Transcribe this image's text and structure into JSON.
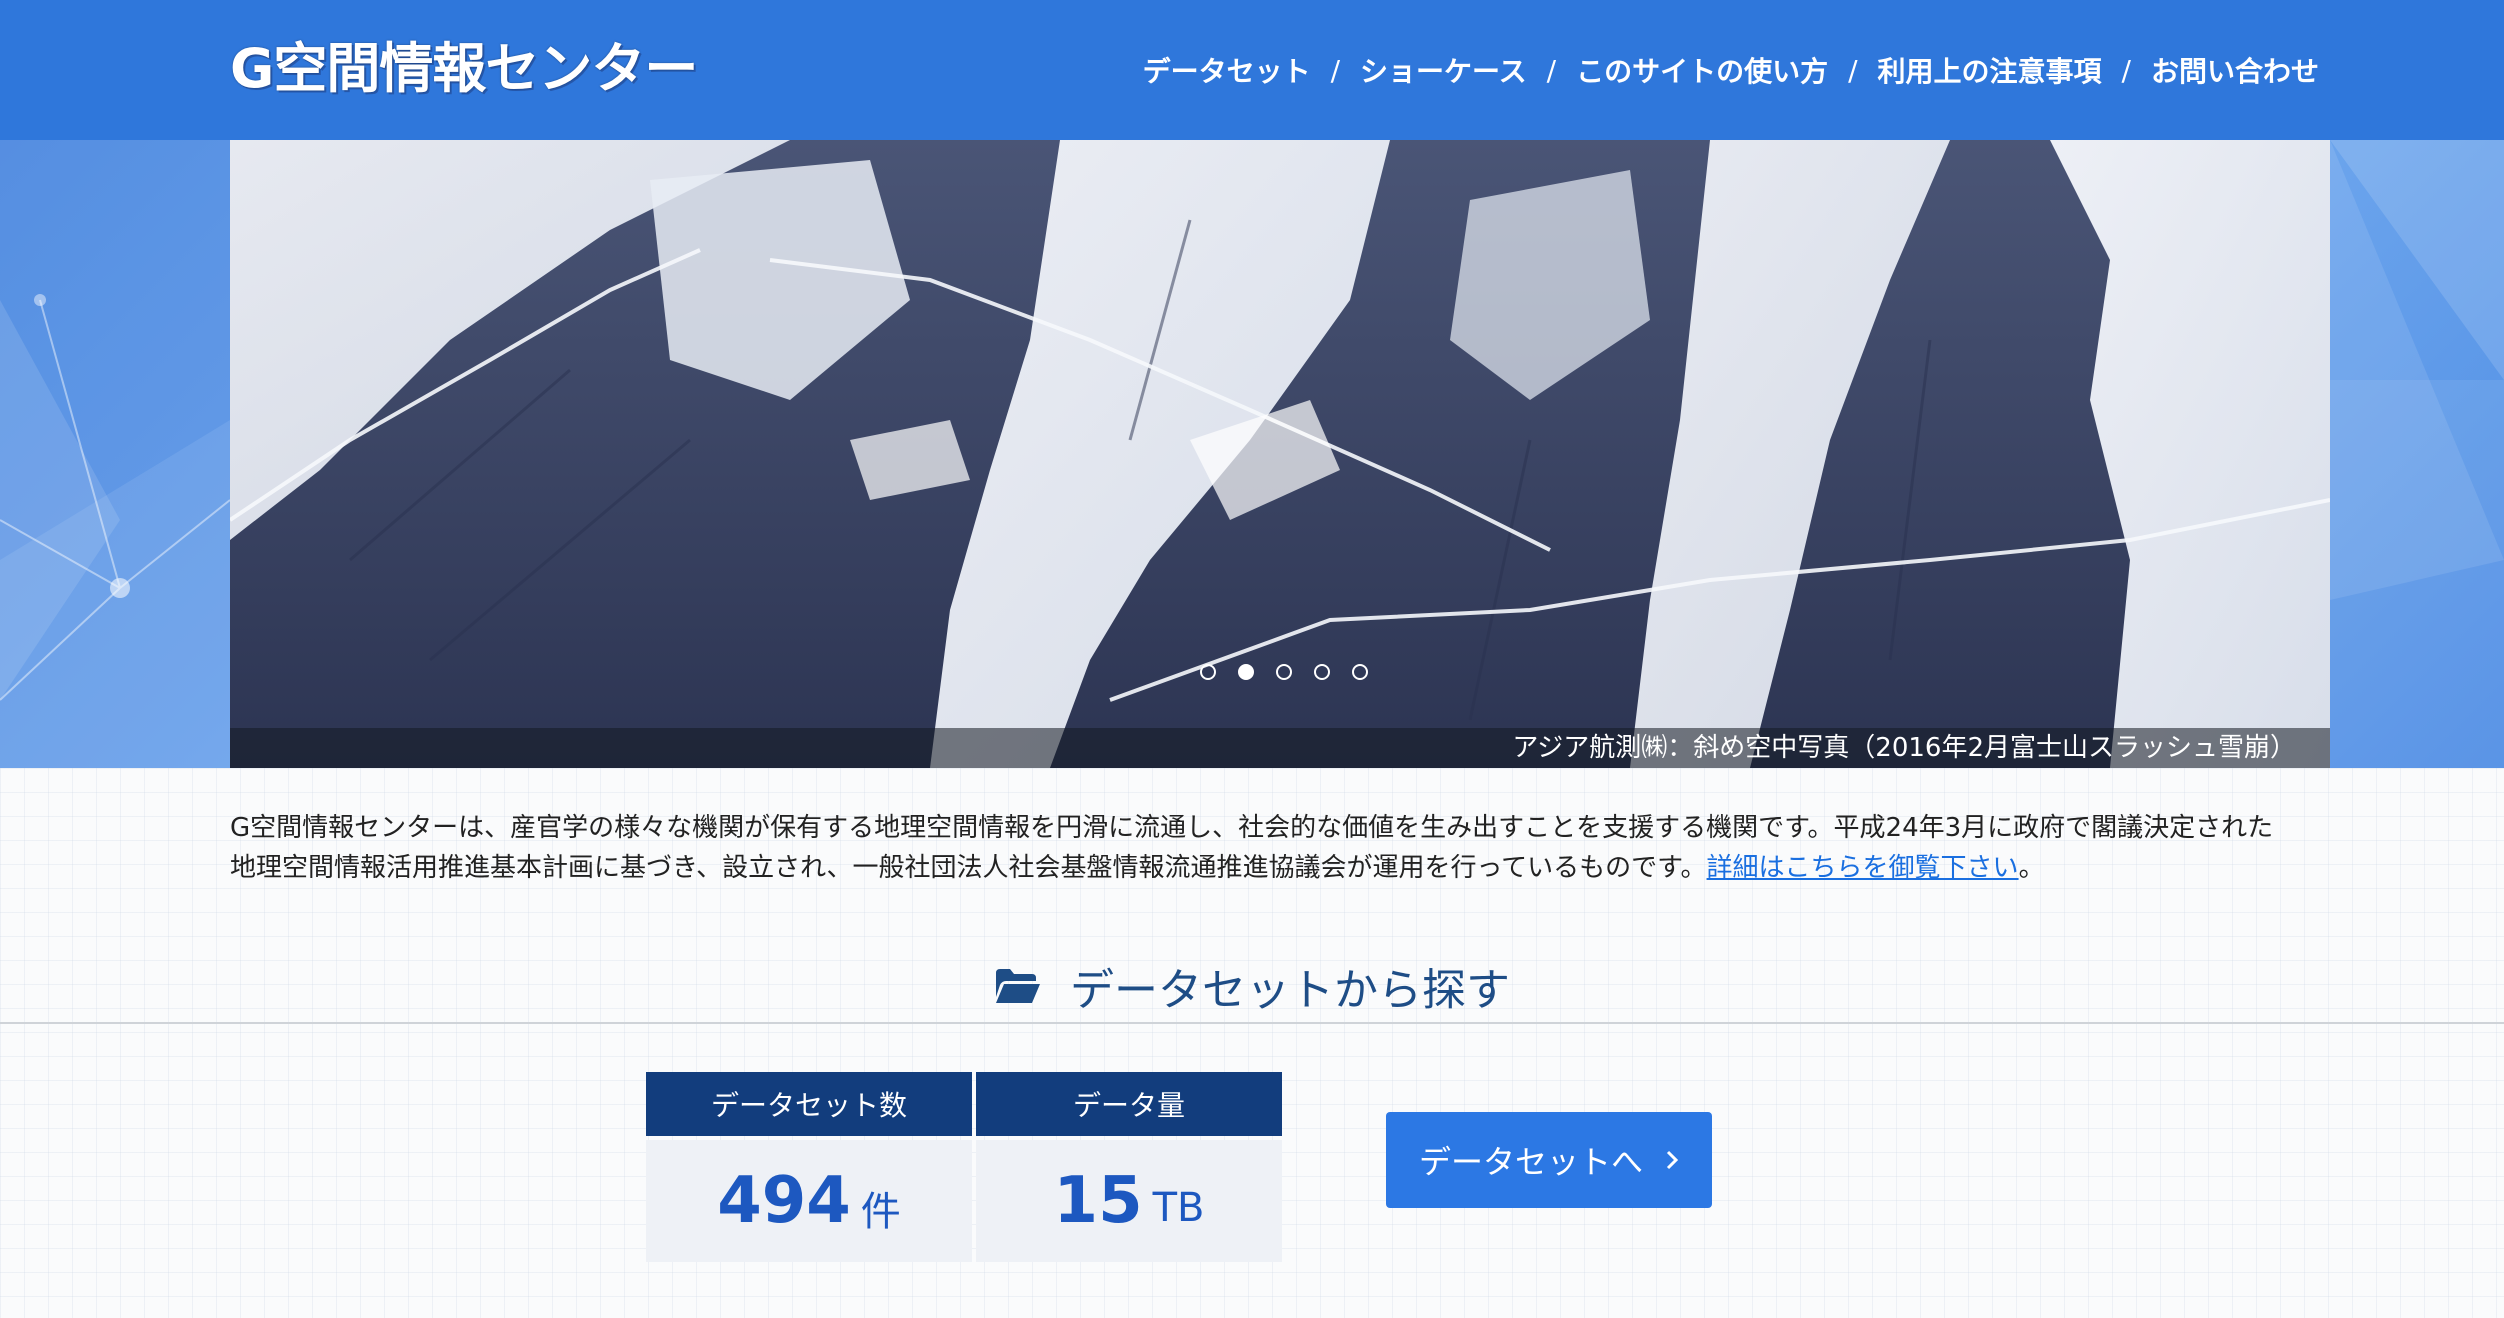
{
  "site": {
    "logo_text": "G空間情報センター"
  },
  "nav": {
    "items": [
      "データセット",
      "ショーケース",
      "このサイトの使い方",
      "利用上の注意事項",
      "お問い合わせ"
    ],
    "separator": "/"
  },
  "slider": {
    "caption": "アジア航測㈱：斜め空中写真（2016年2月富士山スラッシュ雪崩）",
    "slide_count": 5,
    "active_index": 1
  },
  "intro": {
    "text": "G空間情報センターは、産官学の様々な機関が保有する地理空間情報を円滑に流通し、社会的な価値を生み出すことを支援する機関です。平成24年3月に政府で閣議決定された地理空間情報活用推進基本計画に基づき、設立され、一般社団法人社会基盤情報流通推進協議会が運用を行っているものです。",
    "link_text": "詳細はこちらを御覧下さい",
    "end": "。"
  },
  "section": {
    "title": "データセットから探す",
    "icon": "folder-open-icon"
  },
  "stats": {
    "dataset_count_label": "データセット数",
    "dataset_count_value": "494",
    "dataset_count_unit": "件",
    "data_volume_label": "データ量",
    "data_volume_value": "15",
    "data_volume_unit": "TB"
  },
  "cta": {
    "label": "データセットへ",
    "icon": "chevron-right-icon"
  },
  "colors": {
    "header_blue": "#2f77db",
    "navy": "#123d7d",
    "accent_blue": "#2c78e4",
    "link_blue": "#1a6fe0",
    "section_title": "#1e4d86"
  }
}
